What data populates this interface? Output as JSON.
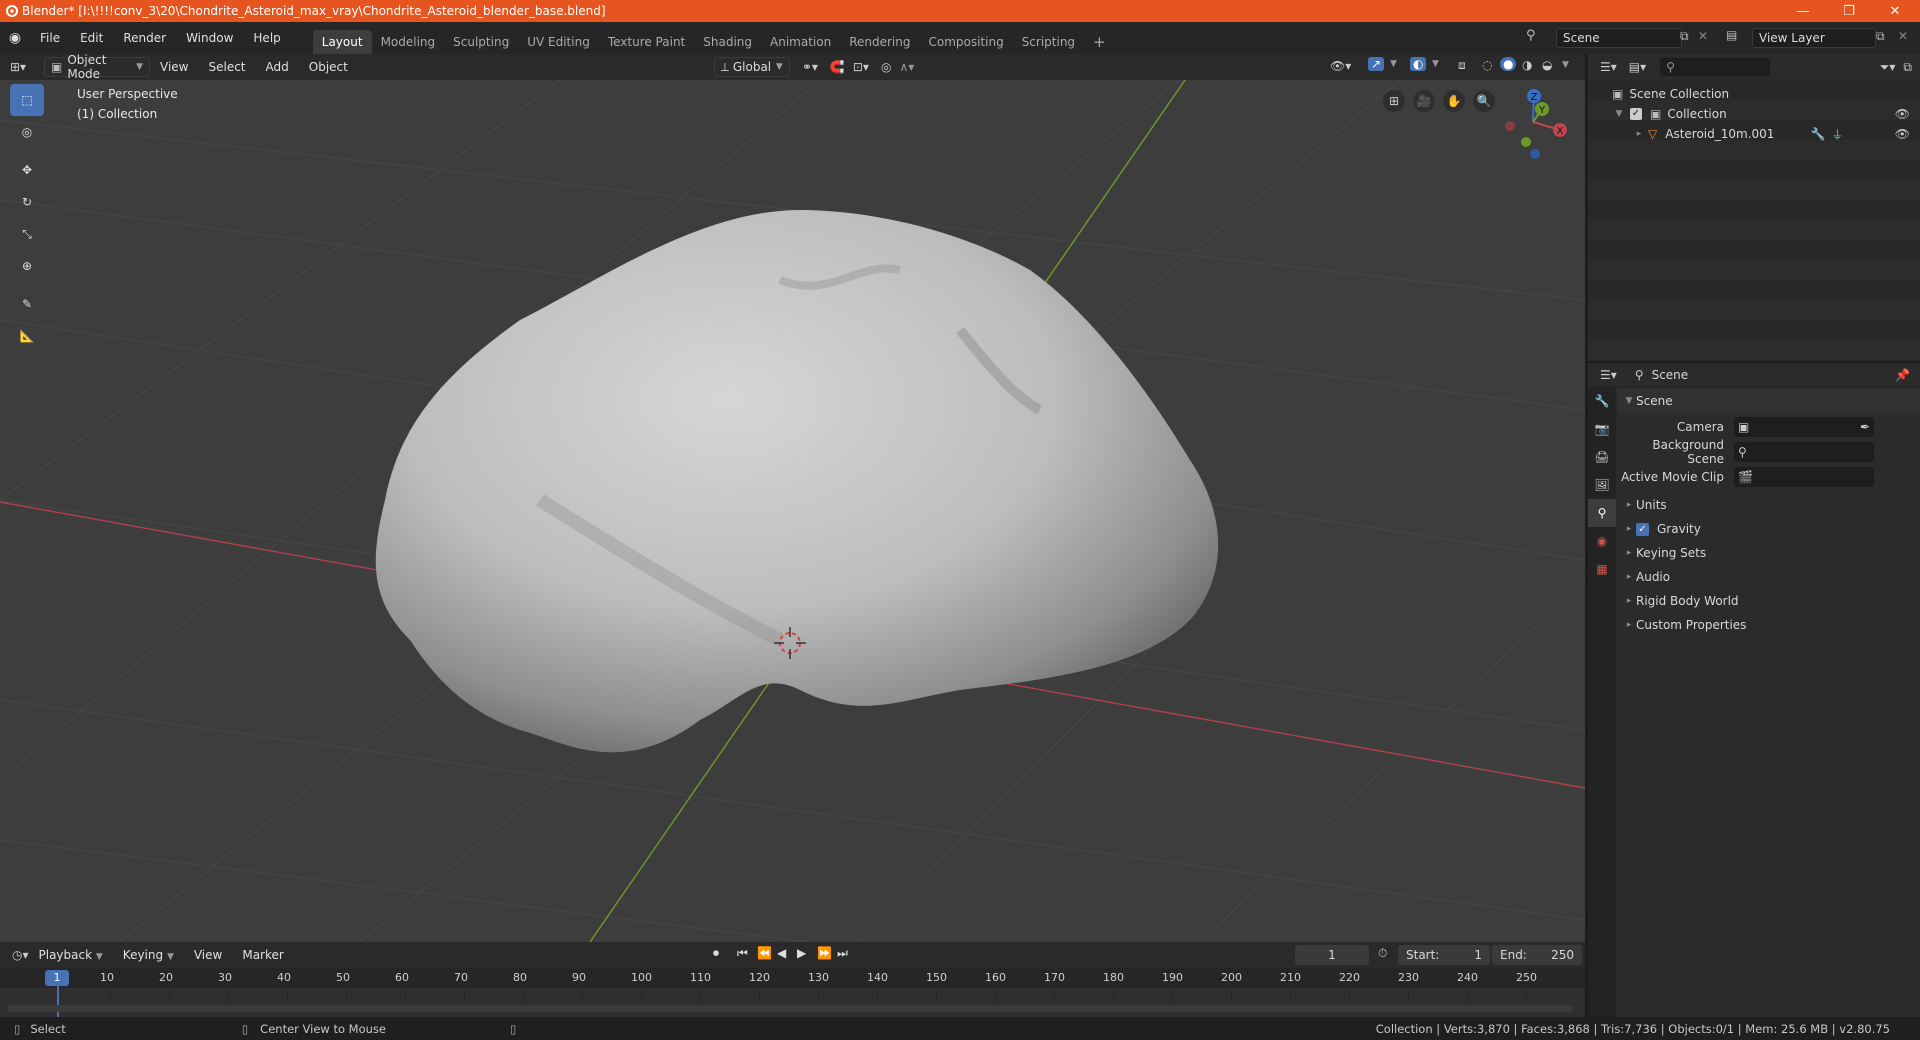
{
  "window": {
    "title": "Blender* [I:\\!!!!conv_3\\20\\Chondrite_Asteroid_max_vray\\Chondrite_Asteroid_blender_base.blend]"
  },
  "menu": [
    "File",
    "Edit",
    "Render",
    "Window",
    "Help"
  ],
  "workspaces": [
    "Layout",
    "Modeling",
    "Sculpting",
    "UV Editing",
    "Texture Paint",
    "Shading",
    "Animation",
    "Rendering",
    "Compositing",
    "Scripting"
  ],
  "scene_selector": "Scene",
  "view_layer_selector": "View Layer",
  "viewport_header": {
    "mode": "Object Mode",
    "menus": [
      "View",
      "Select",
      "Add",
      "Object"
    ],
    "orientation": "Global"
  },
  "viewport": {
    "perspective": "User Perspective",
    "collection": "(1) Collection"
  },
  "gizmo": {
    "x": "X",
    "y": "Y",
    "z": "Z"
  },
  "outliner": {
    "root": "Scene Collection",
    "collection": "Collection",
    "object": "Asteroid_10m.001"
  },
  "properties": {
    "header": "Scene",
    "panel_title": "Scene",
    "fields": [
      {
        "label": "Camera",
        "value": ""
      },
      {
        "label": "Background Scene",
        "value": ""
      },
      {
        "label": "Active Movie Clip",
        "value": ""
      }
    ],
    "sections": [
      "Units",
      "Gravity",
      "Keying Sets",
      "Audio",
      "Rigid Body World",
      "Custom Properties"
    ],
    "gravity_checked": true
  },
  "timeline": {
    "menus": [
      "Playback",
      "Keying",
      "View",
      "Marker"
    ],
    "current_frame": "1",
    "start_label": "Start:",
    "start": "1",
    "end_label": "End:",
    "end": "250",
    "ruler_current": "1",
    "ruler": [
      "10",
      "20",
      "30",
      "40",
      "50",
      "60",
      "70",
      "80",
      "90",
      "100",
      "110",
      "120",
      "130",
      "140",
      "150",
      "160",
      "170",
      "180",
      "190",
      "200",
      "210",
      "220",
      "230",
      "240",
      "250"
    ]
  },
  "statusbar": {
    "left": "Select",
    "middle": "Center View to Mouse",
    "right": "Collection | Verts:3,870 | Faces:3,868 | Tris:7,736 | Objects:0/1 | Mem: 25.6 MB | v2.80.75"
  },
  "colors": {
    "title_bar": "#e65520",
    "accent": "#4772b3",
    "x_axis": "#c0464f",
    "y_axis": "#6a9a2a",
    "z_axis": "#3a6fc7"
  }
}
